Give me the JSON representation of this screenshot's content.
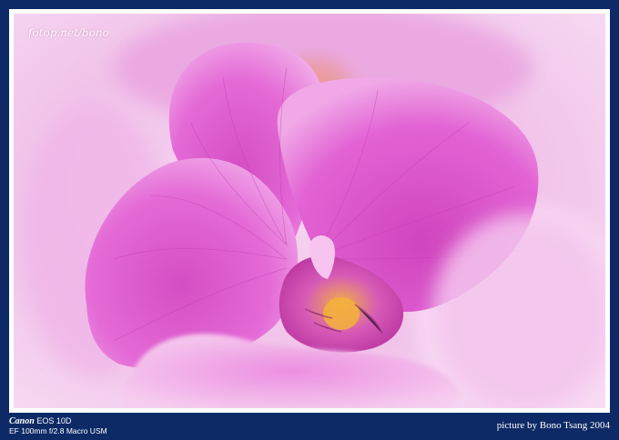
{
  "watermark": "fotop.net/bono",
  "camera": {
    "brand": "Canon",
    "model": "EOS 10D",
    "lens": "EF 100mm f/2.8 Macro USM"
  },
  "credit": "picture by Bono Tsang 2004",
  "colors": {
    "border": "#0d2a66",
    "matte": "#ffffff",
    "petal": "#e05bd0",
    "petal_light": "#f2a9e8",
    "background_blur": "#f4cdee",
    "center_yellow": "#f0a52a"
  }
}
